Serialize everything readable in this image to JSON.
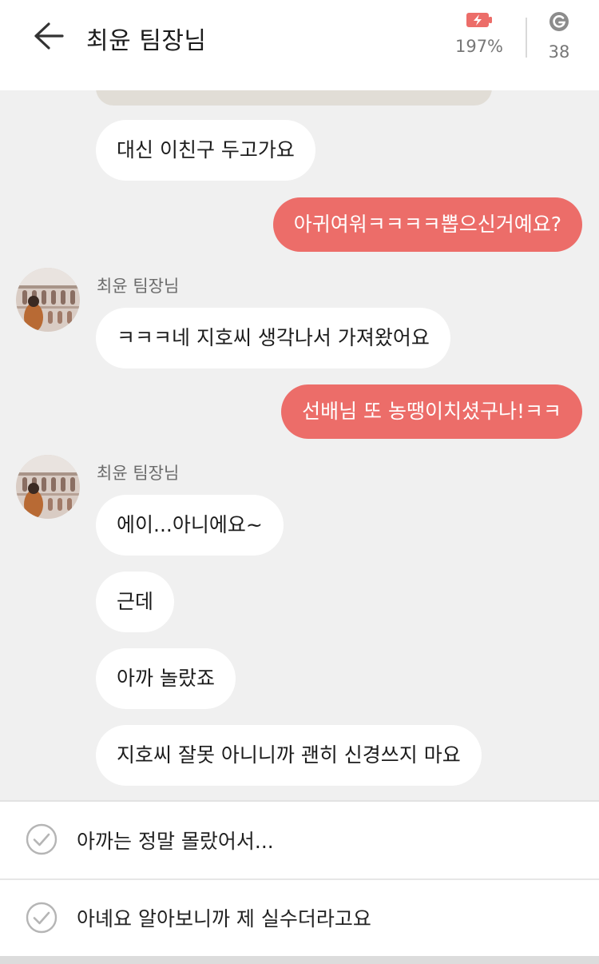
{
  "header": {
    "title": "최윤 팀장님",
    "battery_percent": "197%",
    "gem_count": "38",
    "accent_color": "#ec6d69"
  },
  "messages": [
    {
      "from": "contact",
      "text": "대신 이친구 두고가요"
    },
    {
      "from": "me",
      "text": "아귀여워ㅋㅋㅋㅋ뽑으신거예요?"
    },
    {
      "from": "contact",
      "sender": "최윤 팀장님",
      "text": "ㅋㅋㅋ네 지호씨 생각나서 가져왔어요"
    },
    {
      "from": "me",
      "text": "선배님 또 농땡이치셨구나!ㅋㅋ"
    },
    {
      "from": "contact",
      "sender": "최윤 팀장님",
      "text": "에이...아니에요~"
    },
    {
      "from": "contact",
      "text": "근데"
    },
    {
      "from": "contact",
      "text": "아까 놀랐죠"
    },
    {
      "from": "contact",
      "text": "지호씨 잘못 아니니까 괜히 신경쓰지 마요"
    }
  ],
  "options": [
    {
      "text": "아까는 정말 몰랐어서..."
    },
    {
      "text": "아녜요 알아보니까 제 실수더라고요"
    }
  ]
}
